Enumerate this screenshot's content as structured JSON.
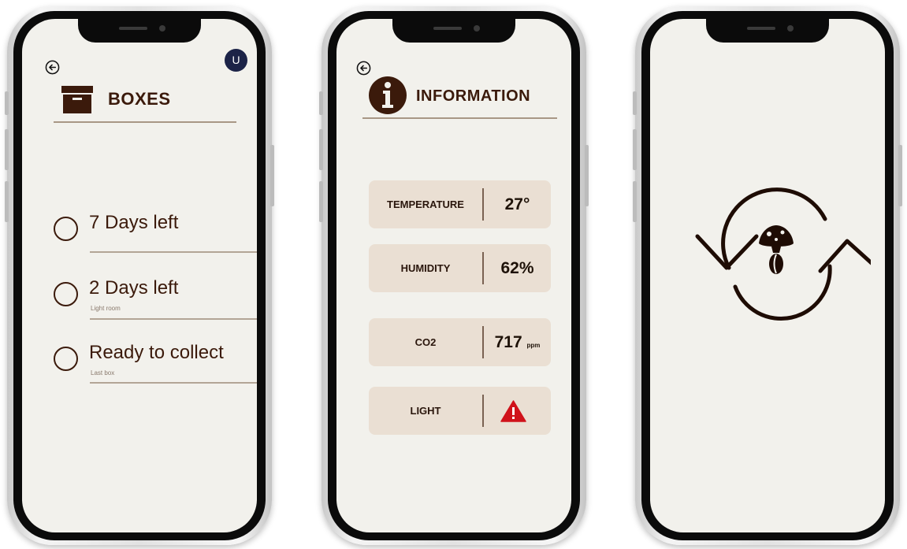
{
  "boxes_screen": {
    "title": "BOXES",
    "avatar_initial": "U",
    "items": [
      {
        "label": "7 Days left",
        "sub": ""
      },
      {
        "label": "2 Days left",
        "sub": "Light room"
      },
      {
        "label": "Ready to collect",
        "sub": "Last box"
      }
    ]
  },
  "info_screen": {
    "title": "INFORMATION",
    "cards": [
      {
        "name": "TEMPERATURE",
        "value": "27°",
        "unit": ""
      },
      {
        "name": "HUMIDITY",
        "value": "62%",
        "unit": ""
      },
      {
        "name": "CO2",
        "value": "717",
        "unit": "ppm"
      },
      {
        "name": "LIGHT",
        "value": "",
        "icon": "warning-icon"
      }
    ]
  },
  "colors": {
    "brown": "#3b1a0b",
    "card_bg": "#eadfd3",
    "screen_bg": "#f2f1ec",
    "warning": "#d0121b"
  }
}
